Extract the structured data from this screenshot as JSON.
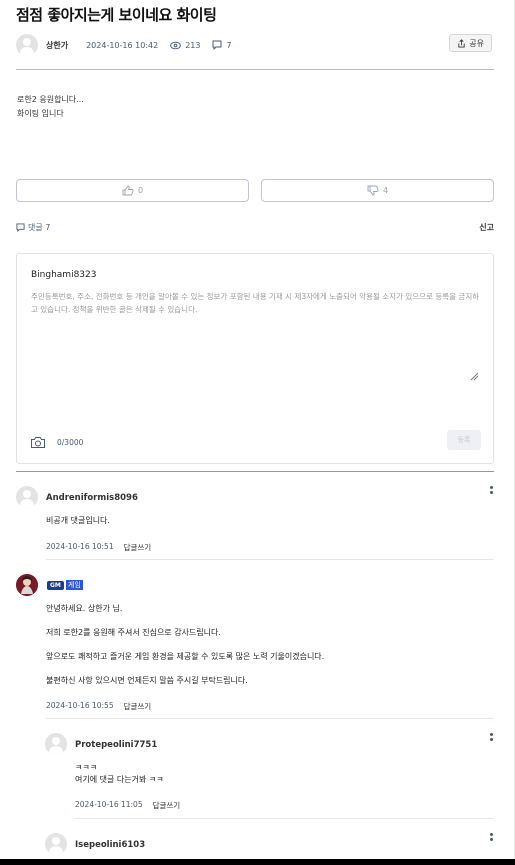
{
  "post": {
    "title": "점점 좋아지는게 보이네요 화이팅",
    "author": "상한가",
    "date": "2024-10-16 10:42",
    "views": "213",
    "comments": "7",
    "share_label": "공유",
    "body_lines": [
      "로한2 응원합니다...",
      "화이팅 입니다"
    ]
  },
  "votes": {
    "up": "0",
    "down": "4"
  },
  "comment_header": {
    "label": "댓글 7",
    "report": "신고"
  },
  "compose": {
    "username": "Binghami8323",
    "placeholder": "주민등록번호, 주소, 전화번호 등 개인을 알아볼 수 있는 정보가 포함된 내용 기재 시 제3자에게 노출되어 악용될 소지가 있으므로 등록을 금지하고 있습니다. 정책을 위반한 글은 삭제될 수 있습니다.",
    "counter": "0/3000",
    "submit_label": "등록"
  },
  "comments": [
    {
      "name": "Andreniformis8096",
      "lines": [
        "비공개 댓글입니다."
      ],
      "date": "2024-10-16 10:51",
      "reply_label": "답글쓰기"
    },
    {
      "badge": "GM",
      "name": "게임",
      "lines": [
        "안녕하세요. 상한가 님.",
        "저희 로한2를 응원해 주셔서 진심으로 감사드립니다.",
        "앞으로도 쾌적하고 즐거운 게임 환경을 제공할 수 있도록 많은 노력 기울이겠습니다.",
        "불편하신 사항 있으시면 언제든지 말씀 주시길 부탁드립니다."
      ],
      "date": "2024-10-16 10:55",
      "reply_label": "답글쓰기"
    },
    {
      "name": "Protepeolini7751",
      "lines": [
        "ㅋㅋㅋ",
        "여기에 댓글 다는거봐 ㅋㅋ"
      ],
      "date": "2024-10-16 11:05",
      "reply_label": "답글쓰기"
    },
    {
      "name": "Isepeolini6103"
    }
  ]
}
